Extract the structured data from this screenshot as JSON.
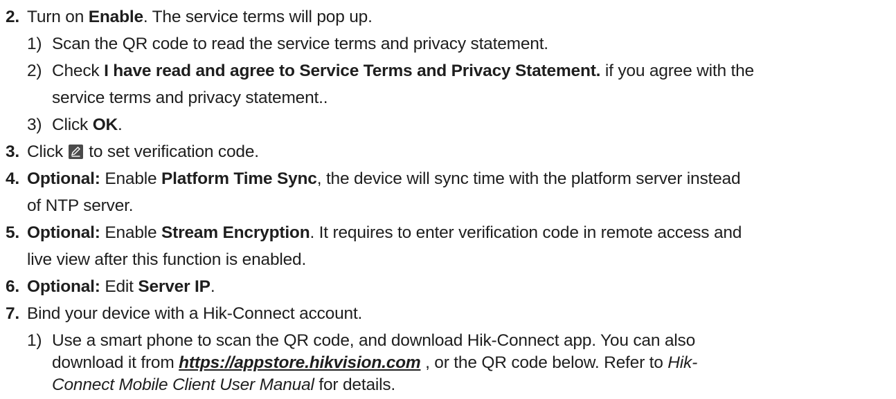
{
  "steps": [
    {
      "num": "2.",
      "t1": "Turn on ",
      "b1": "Enable",
      "t2": ". The service terms will pop up.",
      "substeps": [
        {
          "num": "1)",
          "text": "Scan the QR code to read the service terms and privacy statement."
        },
        {
          "num": "2)",
          "t1": "Check ",
          "b1": "I have read and agree to Service Terms and Privacy Statement.",
          "t2": " if you agree with the",
          "cont": "service terms and privacy statement.."
        },
        {
          "num": "3)",
          "t1": "Click ",
          "b1": "OK",
          "t2": "."
        }
      ]
    },
    {
      "num": "3.",
      "t1": "Click ",
      "icon": "edit-pencil-icon",
      "t2": " to set verification code."
    },
    {
      "num": "4.",
      "b0": "Optional:",
      "t1": " Enable ",
      "b1": "Platform Time Sync",
      "t2": ", the device will sync time with the platform server instead",
      "cont": "of NTP server."
    },
    {
      "num": "5.",
      "b0": "Optional:",
      "t1": " Enable ",
      "b1": "Stream Encryption",
      "t2": ". It requires to enter verification code in remote access and",
      "cont": "live view after this function is enabled."
    },
    {
      "num": "6.",
      "b0": "Optional:",
      "t1": " Edit ",
      "b1": "Server IP",
      "t2": "."
    },
    {
      "num": "7.",
      "t1": "Bind your device with a Hik-Connect account.",
      "substeps": [
        {
          "num": "1)",
          "l1": "Use a smart phone to scan the QR code, and download Hik-Connect app. You can also",
          "l2a": "download it from ",
          "link": "https://appstore.hikvision.com",
          "l2b": " , or the QR code below. Refer to ",
          "l2i": "Hik-",
          "l3i": "Connect Mobile Client User Manual",
          "l3b": " for details."
        }
      ]
    }
  ],
  "colors": {
    "text": "#1e1e1e",
    "icon_bg": "#4a4a4a"
  }
}
